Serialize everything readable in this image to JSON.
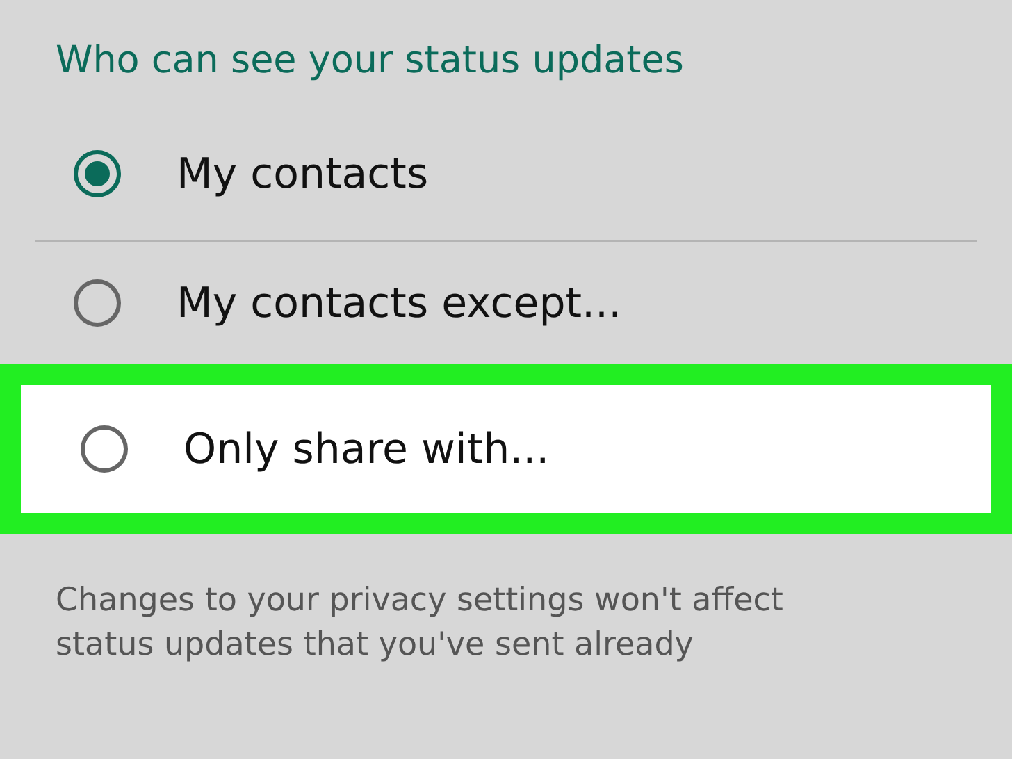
{
  "title": "Who can see your status updates",
  "options": [
    {
      "label": "My contacts",
      "selected": true,
      "highlighted": false
    },
    {
      "label": "My contacts except...",
      "selected": false,
      "highlighted": false
    },
    {
      "label": "Only share with...",
      "selected": false,
      "highlighted": true
    }
  ],
  "note": "Changes to your privacy settings won't affect status updates that you've sent already"
}
